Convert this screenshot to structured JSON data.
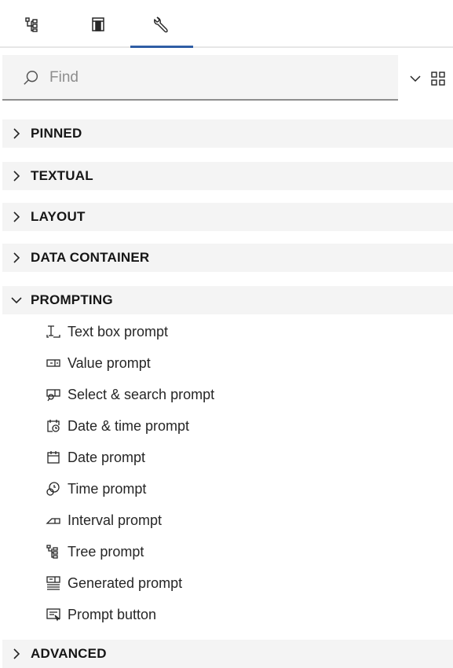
{
  "tabs": [
    {
      "icon": "tree-icon",
      "label": "Data tree"
    },
    {
      "icon": "page-layout-icon",
      "label": "Pages"
    },
    {
      "icon": "toolbox-wrench-icon",
      "label": "Toolbox"
    }
  ],
  "active_tab": 2,
  "search": {
    "placeholder": "Find",
    "value": ""
  },
  "sections": [
    {
      "label": "PINNED",
      "expanded": false
    },
    {
      "label": "TEXTUAL",
      "expanded": false
    },
    {
      "label": "LAYOUT",
      "expanded": false
    },
    {
      "label": "DATA CONTAINER",
      "expanded": false
    },
    {
      "label": "PROMPTING",
      "expanded": true
    },
    {
      "label": "ADVANCED",
      "expanded": false
    }
  ],
  "prompting_items": [
    {
      "label": "Text box prompt",
      "icon": "text-box-prompt-icon"
    },
    {
      "label": "Value prompt",
      "icon": "value-prompt-icon"
    },
    {
      "label": "Select & search prompt",
      "icon": "select-search-prompt-icon"
    },
    {
      "label": "Date & time prompt",
      "icon": "date-time-prompt-icon"
    },
    {
      "label": "Date prompt",
      "icon": "calendar-icon"
    },
    {
      "label": "Time prompt",
      "icon": "clock-icon"
    },
    {
      "label": "Interval prompt",
      "icon": "interval-prompt-icon"
    },
    {
      "label": "Tree prompt",
      "icon": "tree-icon"
    },
    {
      "label": "Generated prompt",
      "icon": "generated-prompt-icon"
    },
    {
      "label": "Prompt button",
      "icon": "prompt-button-icon"
    }
  ],
  "colors": {
    "accent": "#2f5ea5",
    "header_bg": "#f4f4f4",
    "text": "#161616",
    "placeholder": "#8d8d8d"
  }
}
